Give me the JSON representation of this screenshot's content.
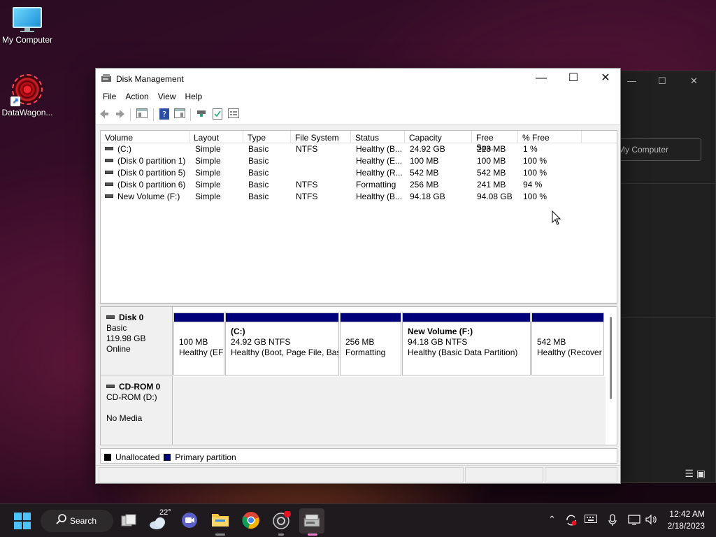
{
  "desktop": {
    "icons": [
      {
        "label": "My Computer"
      },
      {
        "label": "DataWagon..."
      }
    ],
    "background_window": {
      "address_text": "My Computer"
    }
  },
  "window": {
    "title": "Disk Management",
    "menu": [
      "File",
      "Action",
      "View",
      "Help"
    ],
    "volume_table": {
      "columns": [
        "Volume",
        "Layout",
        "Type",
        "File System",
        "Status",
        "Capacity",
        "Free Spa...",
        "% Free"
      ],
      "rows": [
        [
          "(C:)",
          "Simple",
          "Basic",
          "NTFS",
          "Healthy (B...",
          "24.92 GB",
          "213 MB",
          "1 %"
        ],
        [
          "(Disk 0 partition 1)",
          "Simple",
          "Basic",
          "",
          "Healthy (E...",
          "100 MB",
          "100 MB",
          "100 %"
        ],
        [
          "(Disk 0 partition 5)",
          "Simple",
          "Basic",
          "",
          "Healthy (R...",
          "542 MB",
          "542 MB",
          "100 %"
        ],
        [
          "(Disk 0 partition 6)",
          "Simple",
          "Basic",
          "NTFS",
          "Formatting",
          "256 MB",
          "241 MB",
          "94 %"
        ],
        [
          "New Volume (F:)",
          "Simple",
          "Basic",
          "NTFS",
          "Healthy (B...",
          "94.18 GB",
          "94.08 GB",
          "100 %"
        ]
      ]
    },
    "disks": [
      {
        "name": "Disk 0",
        "type": "Basic",
        "size": "119.98 GB",
        "state": "Online",
        "partitions": [
          {
            "title": "",
            "line1": "100 MB",
            "line2": "Healthy (EF"
          },
          {
            "title": "(C:)",
            "line1": "24.92 GB NTFS",
            "line2": "Healthy (Boot, Page File, Bas"
          },
          {
            "title": "",
            "line1": "256 MB",
            "line2": "Formatting"
          },
          {
            "title": "New Volume  (F:)",
            "line1": "94.18 GB NTFS",
            "line2": "Healthy (Basic Data Partition)"
          },
          {
            "title": "",
            "line1": "542 MB",
            "line2": "Healthy (Recover"
          }
        ]
      },
      {
        "name": "CD-ROM 0",
        "type": "CD-ROM (D:)",
        "state": "No Media"
      }
    ],
    "legend": [
      {
        "label": "Unallocated",
        "color": "#000000"
      },
      {
        "label": "Primary partition",
        "color": "#00007b"
      }
    ]
  },
  "taskbar": {
    "search_label": "Search",
    "weather_temp": "22°",
    "time": "12:42 AM",
    "date": "2/18/2023"
  },
  "colors": {
    "partition_bar": "#00007b",
    "start_accent": "#4cc2ff"
  }
}
